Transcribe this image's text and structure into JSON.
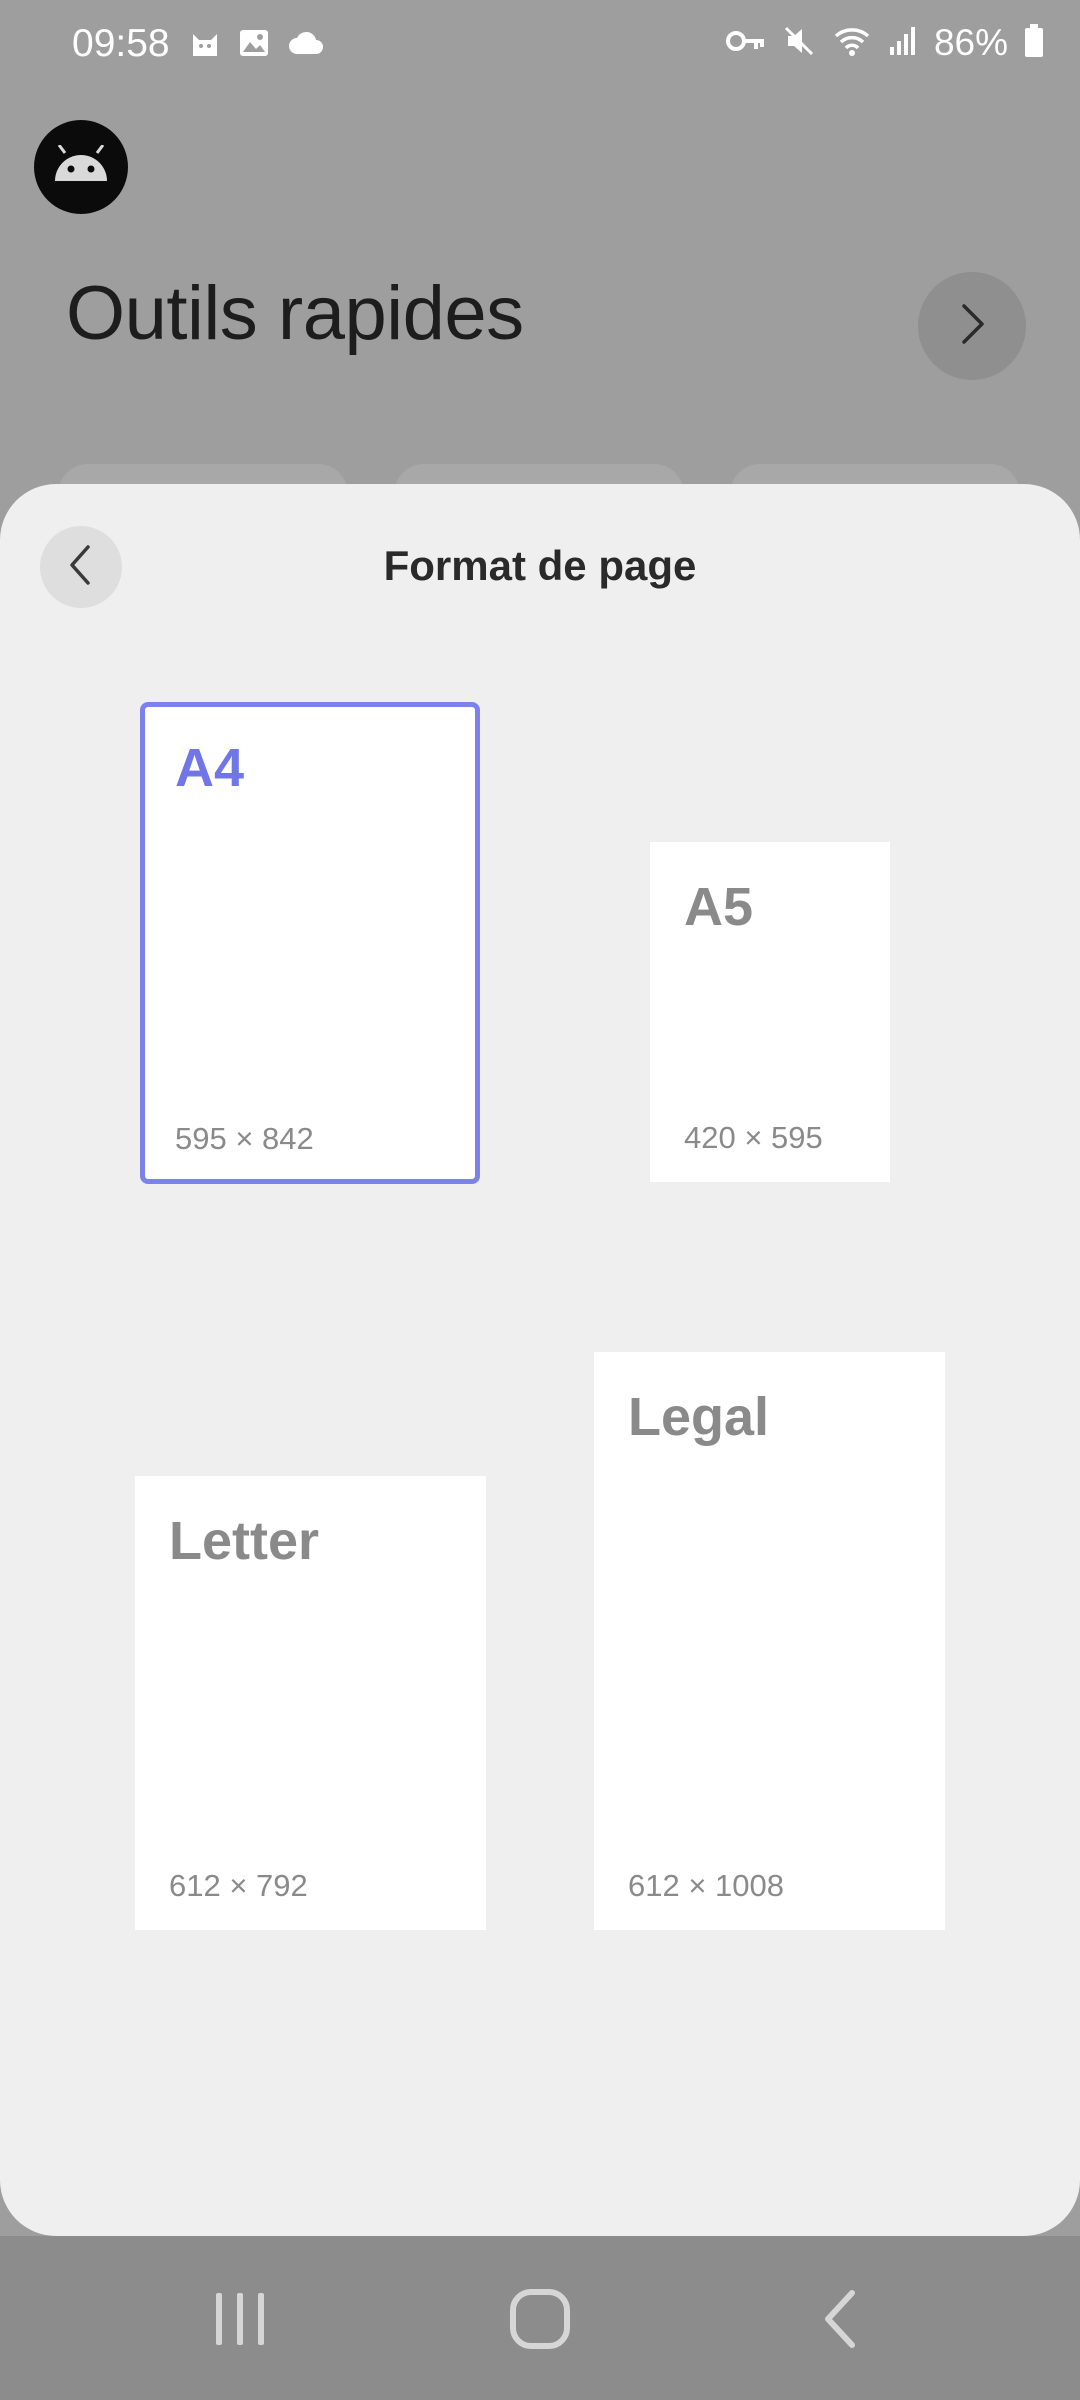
{
  "status_bar": {
    "time": "09:58",
    "battery": "86%",
    "left_icons": [
      "cat-icon",
      "image-icon",
      "cloud-icon"
    ],
    "right_icons": [
      "key-icon",
      "mute-icon",
      "wifi-icon",
      "signal-icon",
      "battery-icon"
    ]
  },
  "background_app": {
    "title": "Outils rapides"
  },
  "sheet": {
    "title": "Format de page",
    "formats": [
      {
        "name": "A4",
        "dims": "595 × 842",
        "selected": true
      },
      {
        "name": "A5",
        "dims": "420 × 595",
        "selected": false
      },
      {
        "name": "Letter",
        "dims": "612 × 792",
        "selected": false
      },
      {
        "name": "Legal",
        "dims": "612 × 1008",
        "selected": false
      }
    ]
  },
  "colors": {
    "accent": "#7b83ea",
    "sheet_bg": "#efefef",
    "scrim_bg": "#9e9e9e"
  }
}
